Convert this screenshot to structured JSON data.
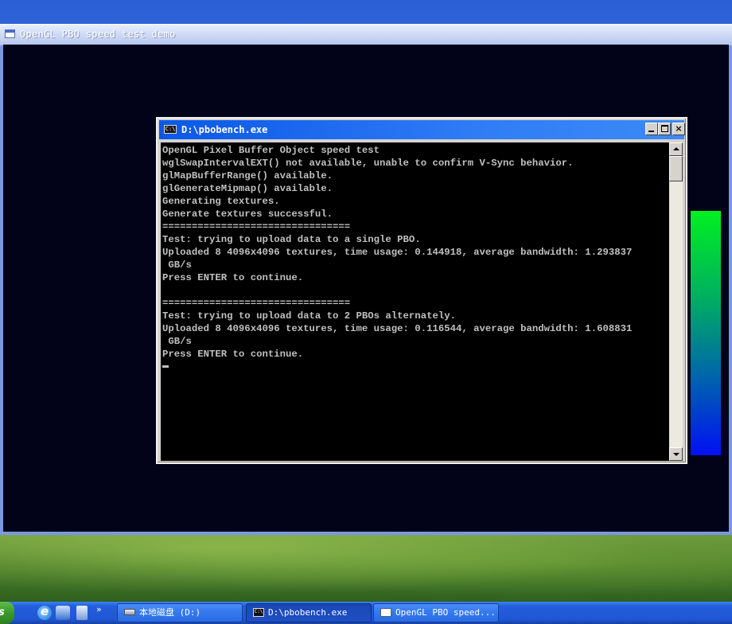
{
  "gl_window": {
    "title": "OpenGL PBO speed test demo"
  },
  "console": {
    "title": "D:\\pbobench.exe",
    "icon_text": "C:\\",
    "lines": [
      "OpenGL Pixel Buffer Object speed test",
      "wglSwapIntervalEXT() not available, unable to confirm V-Sync behavior.",
      "glMapBufferRange() available.",
      "glGenerateMipmap() available.",
      "Generating textures.",
      "Generate textures successful.",
      "================================",
      "Test: trying to upload data to a single PBO.",
      "Uploaded 8 4096x4096 textures, time usage: 0.144918, average bandwidth: 1.293837",
      " GB/s",
      "Press ENTER to continue.",
      "",
      "================================",
      "Test: trying to upload data to 2 PBOs alternately.",
      "Uploaded 8 4096x4096 textures, time usage: 0.116544, average bandwidth: 1.608831",
      " GB/s",
      "Press ENTER to continue."
    ],
    "buttons": {
      "close": "×"
    }
  },
  "taskbar": {
    "start_label": "s",
    "quick_launch_expand": "»",
    "tasks": [
      {
        "label": "本地磁盘 (D:)",
        "icon": "drive-icon"
      },
      {
        "label": "D:\\pbobench.exe",
        "icon": "console-icon"
      },
      {
        "label": "OpenGL PBO speed...",
        "icon": "window-icon"
      }
    ]
  },
  "colors": {
    "console_text": "#c0c0c0",
    "console_title_bar": "#0a58e8",
    "gl_background": "#020318",
    "taskbar": "#245edb"
  }
}
